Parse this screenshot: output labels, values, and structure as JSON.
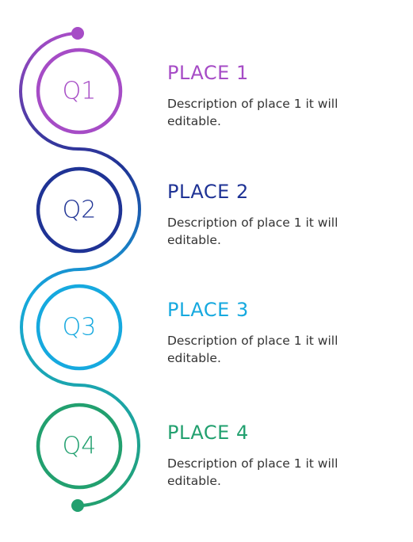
{
  "colors": {
    "purple": "#a64cc6",
    "navy": "#1f3395",
    "blue": "#16a9df",
    "green": "#22a06f"
  },
  "steps": [
    {
      "label": "Q1",
      "title": "PLACE  1",
      "description": "Description of place 1 it will editable.",
      "color": "#a64cc6"
    },
    {
      "label": "Q2",
      "title": "PLACE  2",
      "description": "Description of place 1 it will editable.",
      "color": "#1f3395"
    },
    {
      "label": "Q3",
      "title": "PLACE  3",
      "description": "Description of place 1 it will editable.",
      "color": "#16a9df"
    },
    {
      "label": "Q4",
      "title": "PLACE  4",
      "description": "Description of place 1 it will editable.",
      "color": "#22a06f"
    }
  ]
}
